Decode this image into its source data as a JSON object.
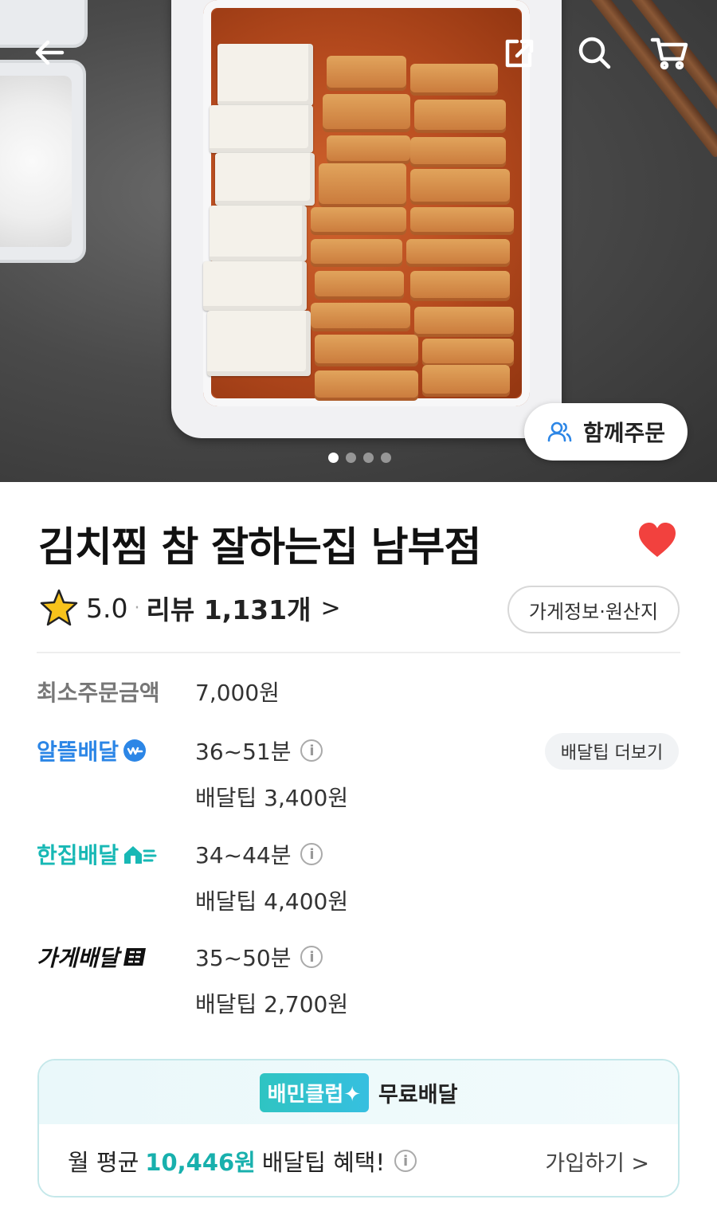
{
  "header": {
    "together_order_label": "함께주문",
    "carousel_total": 4,
    "carousel_active": 1
  },
  "store": {
    "name": "김치찜 참 잘하는집 남부점",
    "rating": "5.0",
    "separator": "·",
    "review_text": "리뷰 1,131개",
    "review_chevron": ">",
    "info_button": "가게정보·원산지",
    "favorite_color": "#f2413e"
  },
  "order": {
    "min_label": "최소주문금액",
    "min_value": "7,000원"
  },
  "delivery": {
    "more_tip_button": "배달팁 더보기",
    "options": [
      {
        "label": "알뜰배달",
        "time": "36~51분",
        "tip": "배달팁 3,400원"
      },
      {
        "label": "한집배달",
        "time": "34~44분",
        "tip": "배달팁 4,400원"
      },
      {
        "label": "가게배달",
        "time": "35~50분",
        "tip": "배달팁 2,700원"
      }
    ],
    "info_symbol": "i"
  },
  "club": {
    "badge": "배민클럽✦",
    "title": "무료배달",
    "prefix": "월 평균",
    "amount": "10,446원",
    "suffix": "배달팁 혜택!",
    "join": "가입하기 >"
  },
  "colors": {
    "altteul": "#2c86e6",
    "hanjip": "#18b8b5",
    "club_accent": "#18b0ad"
  }
}
